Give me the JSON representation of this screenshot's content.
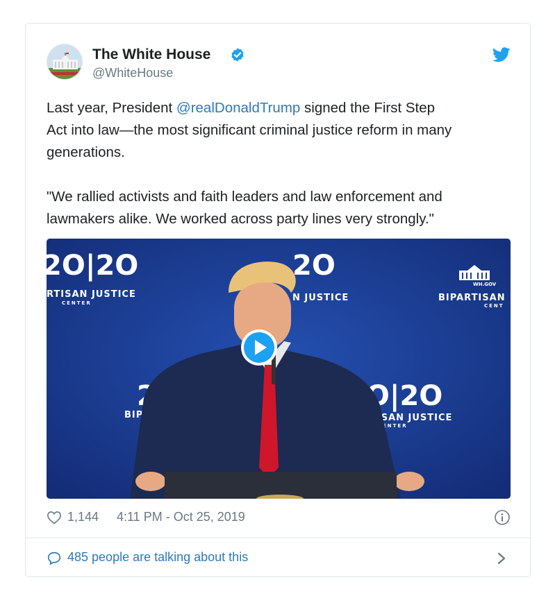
{
  "tweet": {
    "author": {
      "name": "The White House",
      "handle": "@WhiteHouse",
      "avatar_icon": "white-house-avatar-icon",
      "verified_icon": "verified-badge-icon"
    },
    "brand_icon": "twitter-bird-icon",
    "text": {
      "line1_pre": "Last year, President ",
      "mention": "@realDonaldTrump",
      "line1_post": " signed the First Step",
      "line2": "Act into law—the most significant criminal justice reform in many",
      "line3": "generations.",
      "quote_line1": "\"We rallied activists and faith leaders and law enforcement and",
      "quote_line2": "lawmakers alike. We worked across party lines very strongly.\""
    },
    "media": {
      "type": "video",
      "play_icon": "play-icon",
      "backdrop_texts": {
        "logo_left": "2O|2O",
        "caption_left": "RTISAN JUSTICE",
        "caption_left_sub": "CENTER",
        "logo_center": "2O",
        "caption_center": "N JUSTICE",
        "caption_right": "BIPARTISAN",
        "caption_right_sub": "CENT",
        "logo_right_top": "WH.GOV",
        "logo_mid_left": "2",
        "caption_mid_left": "BIPA",
        "logo_mid_right": "2O|2O",
        "caption_mid_right": "TISAN JUSTICE",
        "caption_mid_right_sub": "ENTER"
      }
    },
    "stats": {
      "likes": "1,144",
      "timestamp": "4:11 PM - Oct 25, 2019",
      "heart_icon": "heart-icon",
      "info_icon": "info-icon"
    },
    "conversation": {
      "label": "485 people are talking about this",
      "comment_icon": "comment-icon",
      "chevron_icon": "chevron-right-icon"
    }
  },
  "colors": {
    "link": "#2b7bb9",
    "twitter_blue": "#1da1f2",
    "muted": "#697882",
    "media_bg": "#1b3c8f"
  }
}
